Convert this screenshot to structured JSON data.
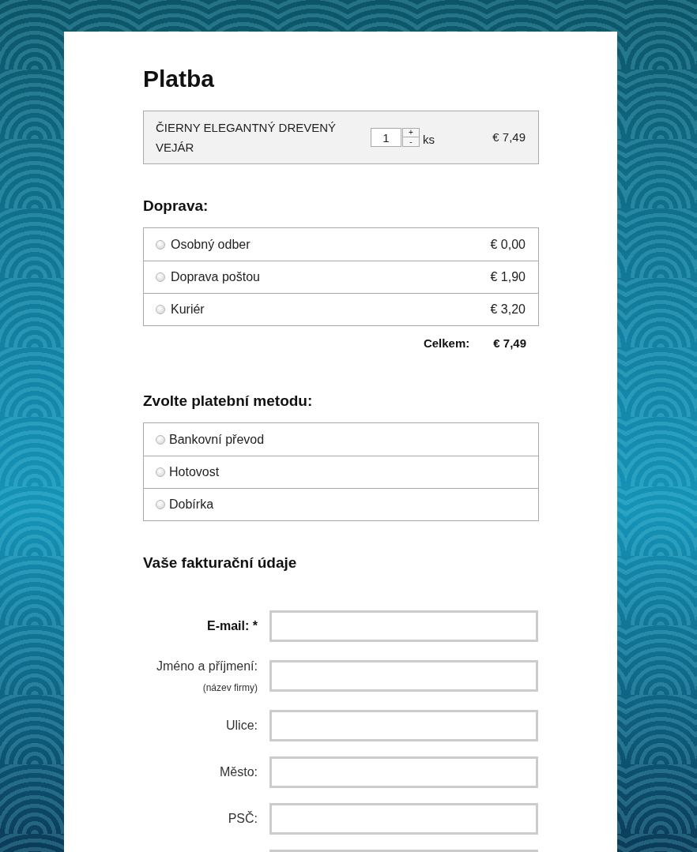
{
  "title": "Platba",
  "cart": {
    "items": [
      {
        "name": "ČIERNY ELEGANTNÝ DREVENÝ VEJÁR",
        "quantity": "1",
        "increment": "+",
        "decrement": "-",
        "unit": "ks",
        "price": "€ 7,49"
      }
    ]
  },
  "shipping": {
    "heading": "Doprava:",
    "options": [
      {
        "label": "Osobný odber",
        "price": "€ 0,00",
        "selected": false
      },
      {
        "label": "Doprava poštou",
        "price": "€ 1,90",
        "selected": false
      },
      {
        "label": "Kuriér",
        "price": "€ 3,20",
        "selected": false
      }
    ]
  },
  "total": {
    "label": "Celkem:",
    "value": "€ 7,49"
  },
  "payment": {
    "heading": "Zvolte platební metodu:",
    "options": [
      {
        "label": "Bankovní převod",
        "selected": false
      },
      {
        "label": "Hotovost",
        "selected": false
      },
      {
        "label": "Dobírka",
        "selected": false
      }
    ]
  },
  "billing": {
    "heading": "Vaše fakturační údaje",
    "fields": [
      {
        "kind": "text",
        "label": "E-mail: *",
        "required": true
      },
      {
        "kind": "text",
        "label": "Jméno a příjmení:",
        "hint": "(název firmy)",
        "required": false
      },
      {
        "kind": "text",
        "label": "Ulice:",
        "required": false
      },
      {
        "kind": "text",
        "label": "Město:",
        "required": false
      },
      {
        "kind": "text",
        "label": "PSČ:",
        "required": false
      },
      {
        "kind": "text"
      }
    ]
  }
}
